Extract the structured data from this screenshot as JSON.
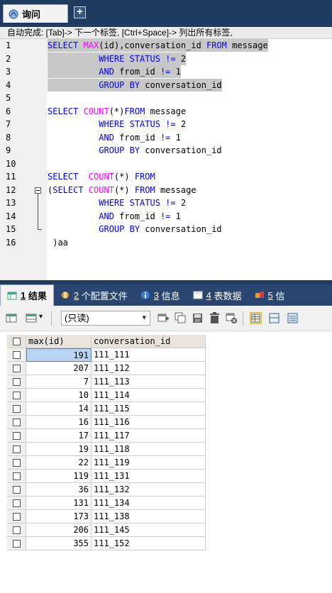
{
  "top_tabs": {
    "query_label": "询问",
    "add_tab_symbol": "+"
  },
  "hint": "自动完成: [Tab]-> 下一个标签, [Ctrl+Space]-> 列出所有标签,",
  "editor": {
    "lines": [
      {
        "num": "1",
        "parts": [
          [
            "kw",
            "SELECT "
          ],
          [
            "fn",
            "MAX"
          ],
          [
            "txt",
            "(id),conversation_id "
          ],
          [
            "kw",
            "FROM"
          ],
          [
            "txt",
            " message"
          ]
        ],
        "selected": true
      },
      {
        "num": "2",
        "parts": [
          [
            "txt",
            "          "
          ],
          [
            "kw",
            "WHERE STATUS != "
          ],
          [
            "txt",
            "2"
          ]
        ],
        "selected": true
      },
      {
        "num": "3",
        "parts": [
          [
            "txt",
            "          "
          ],
          [
            "kw",
            "AND "
          ],
          [
            "txt",
            "from_id "
          ],
          [
            "kw",
            "!= "
          ],
          [
            "txt",
            "1"
          ]
        ],
        "selected": true
      },
      {
        "num": "4",
        "parts": [
          [
            "txt",
            "          "
          ],
          [
            "kw",
            "GROUP BY "
          ],
          [
            "txt",
            "conversation_id"
          ]
        ],
        "selected": true
      },
      {
        "num": "5",
        "parts": [],
        "selected": false
      },
      {
        "num": "6",
        "parts": [
          [
            "kw",
            "SELECT "
          ],
          [
            "fn",
            "COUNT"
          ],
          [
            "txt",
            "(*)"
          ],
          [
            "kw",
            "FROM"
          ],
          [
            "txt",
            " message"
          ]
        ],
        "selected": false
      },
      {
        "num": "7",
        "parts": [
          [
            "txt",
            "          "
          ],
          [
            "kw",
            "WHERE STATUS != "
          ],
          [
            "txt",
            "2"
          ]
        ],
        "selected": false
      },
      {
        "num": "8",
        "parts": [
          [
            "txt",
            "          "
          ],
          [
            "kw",
            "AND "
          ],
          [
            "txt",
            "from_id "
          ],
          [
            "kw",
            "!= "
          ],
          [
            "txt",
            "1"
          ]
        ],
        "selected": false
      },
      {
        "num": "9",
        "parts": [
          [
            "txt",
            "          "
          ],
          [
            "kw",
            "GROUP BY "
          ],
          [
            "txt",
            "conversation_id"
          ]
        ],
        "selected": false
      },
      {
        "num": "10",
        "parts": [],
        "selected": false
      },
      {
        "num": "11",
        "parts": [
          [
            "kw",
            "SELECT  "
          ],
          [
            "fn",
            "COUNT"
          ],
          [
            "txt",
            "(*) "
          ],
          [
            "kw",
            "FROM"
          ]
        ],
        "selected": false
      },
      {
        "num": "12",
        "parts": [
          [
            "txt",
            "("
          ],
          [
            "kw",
            "SELECT "
          ],
          [
            "fn",
            "COUNT"
          ],
          [
            "txt",
            "(*) "
          ],
          [
            "kw",
            "FROM"
          ],
          [
            "txt",
            " message"
          ]
        ],
        "selected": false
      },
      {
        "num": "13",
        "parts": [
          [
            "txt",
            "          "
          ],
          [
            "kw",
            "WHERE STATUS != "
          ],
          [
            "txt",
            "2"
          ]
        ],
        "selected": false
      },
      {
        "num": "14",
        "parts": [
          [
            "txt",
            "          "
          ],
          [
            "kw",
            "AND "
          ],
          [
            "txt",
            "from_id "
          ],
          [
            "kw",
            "!= "
          ],
          [
            "txt",
            "1"
          ]
        ],
        "selected": false
      },
      {
        "num": "15",
        "parts": [
          [
            "txt",
            "          "
          ],
          [
            "kw",
            "GROUP BY "
          ],
          [
            "txt",
            "conversation_id"
          ]
        ],
        "selected": false
      },
      {
        "num": "16",
        "parts": [
          [
            "txt",
            " )aa"
          ]
        ],
        "selected": false
      }
    ]
  },
  "result_tabs": [
    {
      "num": "1",
      "label": "结果",
      "icon": "result-table-icon",
      "active": true
    },
    {
      "num": "2",
      "label": "个配置文件",
      "icon": "profile-icon",
      "active": false
    },
    {
      "num": "3",
      "label": "信息",
      "icon": "info-icon",
      "active": false
    },
    {
      "num": "4",
      "label": "表数据",
      "icon": "table-data-icon",
      "active": false
    },
    {
      "num": "5",
      "label": "信",
      "icon": "history-icon",
      "active": false
    }
  ],
  "toolbar": {
    "mode_select": "(只读)",
    "mode_arrow": "▾"
  },
  "grid": {
    "columns": [
      "max(id)",
      "conversation_id"
    ],
    "rows": [
      {
        "max_id": "191",
        "conversation_id": "111_111"
      },
      {
        "max_id": "207",
        "conversation_id": "111_112"
      },
      {
        "max_id": "7",
        "conversation_id": "111_113"
      },
      {
        "max_id": "10",
        "conversation_id": "111_114"
      },
      {
        "max_id": "14",
        "conversation_id": "111_115"
      },
      {
        "max_id": "16",
        "conversation_id": "111_116"
      },
      {
        "max_id": "17",
        "conversation_id": "111_117"
      },
      {
        "max_id": "19",
        "conversation_id": "111_118"
      },
      {
        "max_id": "22",
        "conversation_id": "111_119"
      },
      {
        "max_id": "119",
        "conversation_id": "111_131"
      },
      {
        "max_id": "36",
        "conversation_id": "111_132"
      },
      {
        "max_id": "131",
        "conversation_id": "111_134"
      },
      {
        "max_id": "173",
        "conversation_id": "111_138"
      },
      {
        "max_id": "206",
        "conversation_id": "111_145"
      },
      {
        "max_id": "355",
        "conversation_id": "111_152"
      }
    ]
  },
  "colors": {
    "keyword": "#0000ff",
    "function": "#ff00ff",
    "header_bar": "#1f3b5f",
    "selection": "#c8c8c8"
  }
}
